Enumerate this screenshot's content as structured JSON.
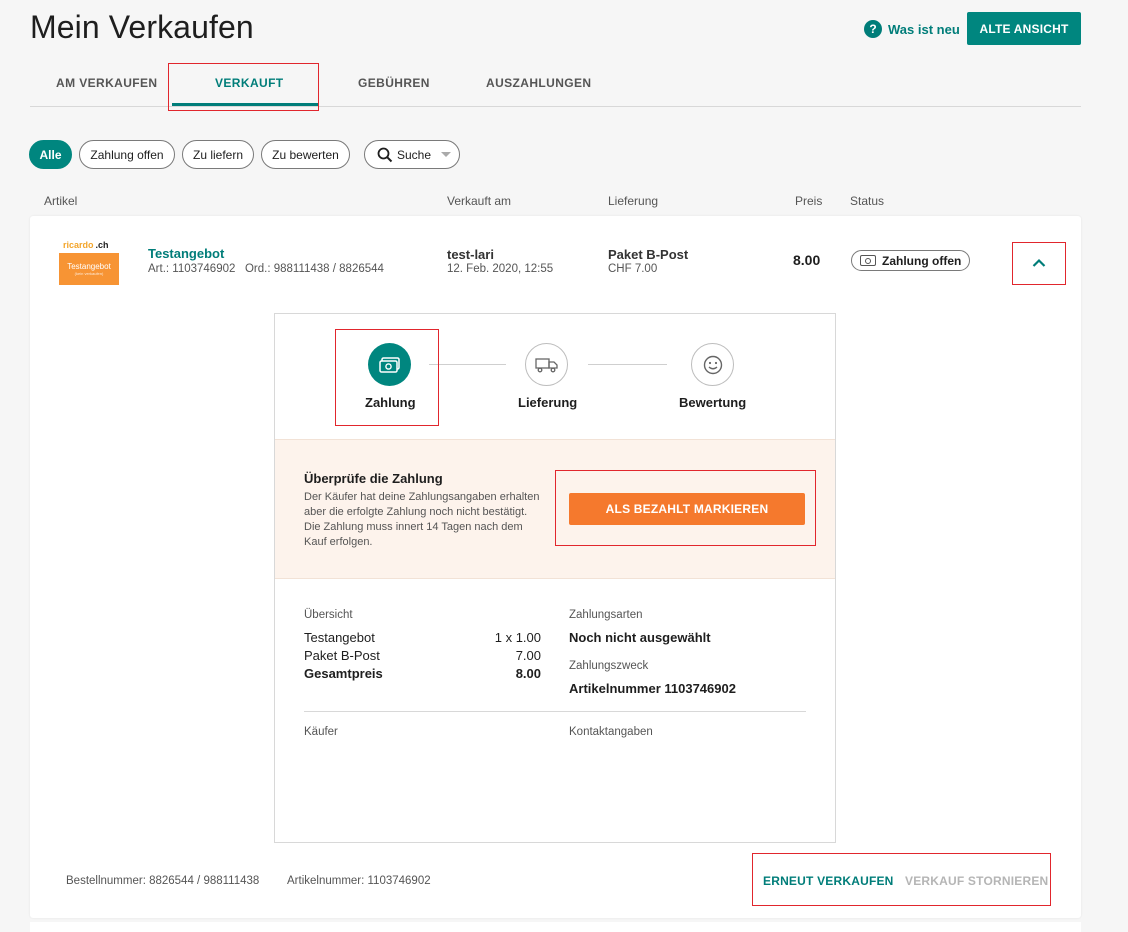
{
  "header": {
    "title": "Mein Verkaufen",
    "help_link": "Was ist neu",
    "help_icon": "?",
    "old_view_button": "ALTE ANSICHT"
  },
  "tabs": [
    {
      "label": "AM VERKAUFEN",
      "active": false
    },
    {
      "label": "VERKAUFT",
      "active": true
    },
    {
      "label": "GEBÜHREN",
      "active": false
    },
    {
      "label": "AUSZAHLUNGEN",
      "active": false
    }
  ],
  "filters": {
    "chips": [
      {
        "label": "Alle",
        "active": true
      },
      {
        "label": "Zahlung offen",
        "active": false
      },
      {
        "label": "Zu liefern",
        "active": false
      },
      {
        "label": "Zu bewerten",
        "active": false
      }
    ],
    "search_label": "Suche"
  },
  "columns": {
    "article": "Artikel",
    "sold_on": "Verkauft am",
    "delivery": "Lieferung",
    "price": "Preis",
    "status": "Status"
  },
  "item": {
    "thumb_brand": "ricardo",
    "thumb_brand_suffix": ".ch",
    "thumb_title": "Testangebot",
    "thumb_sub": "(kein verkaufen)",
    "title": "Testangebot",
    "sub": "Art.: 1103746902   Ord.: 988111438 / 8826544",
    "buyer": "test-lari",
    "sold_date": "12. Feb. 2020, 12:55",
    "shipping": "Paket B-Post",
    "shipping_price": "CHF 7.00",
    "price": "8.00",
    "status": "Zahlung offen"
  },
  "steps": [
    {
      "label": "Zahlung",
      "icon": "cash-icon",
      "active": true
    },
    {
      "label": "Lieferung",
      "icon": "truck-icon",
      "active": false
    },
    {
      "label": "Bewertung",
      "icon": "smiley-icon",
      "active": false
    }
  ],
  "notice": {
    "title": "Überprüfe die Zahlung",
    "text": "Der Käufer hat deine Zahlungsangaben erhalten aber die erfolgte Zahlung noch nicht bestätigt. Die Zahlung muss innert 14 Tagen nach dem Kauf erfolgen.",
    "button": "ALS BEZAHLT MARKIEREN"
  },
  "summary": {
    "heading": "Übersicht",
    "rows": [
      {
        "label": "Testangebot",
        "value": "1 x 1.00",
        "bold": false
      },
      {
        "label": "Paket B-Post",
        "value": "7.00",
        "bold": false
      },
      {
        "label": "Gesamtpreis",
        "value": "8.00",
        "bold": true
      }
    ]
  },
  "payment": {
    "methods_label": "Zahlungsarten",
    "methods_value": "Noch nicht ausgewählt",
    "purpose_label": "Zahlungszweck",
    "purpose_value": "Artikelnummer 1103746902"
  },
  "buyer_section": {
    "buyer_label": "Käufer",
    "contact_label": "Kontaktangaben"
  },
  "footer": {
    "order_number": "Bestellnummer: 8826544 / 988111438",
    "article_number": "Artikelnummer: 1103746902",
    "resell_button": "ERNEUT VERKAUFEN",
    "cancel_button": "VERKAUF STORNIEREN"
  },
  "colors": {
    "accent": "#007d79",
    "orange": "#f5792d",
    "highlight": "#e1262d",
    "notice_bg": "#fdf3ec",
    "disabled": "#b5b5b5"
  }
}
